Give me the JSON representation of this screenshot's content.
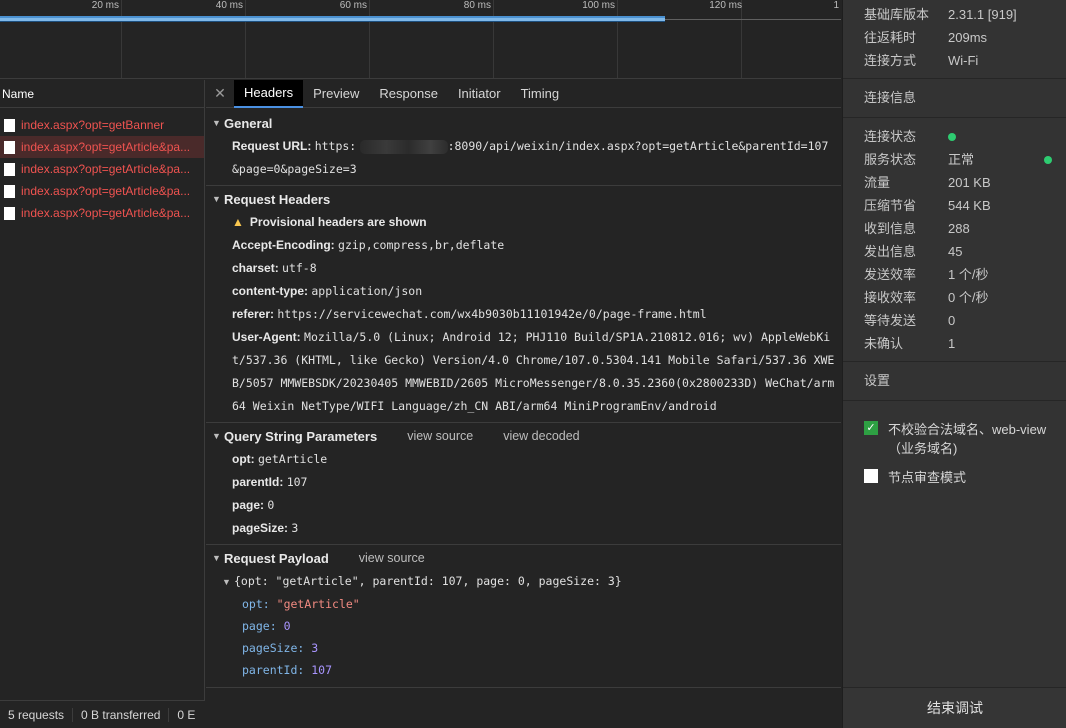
{
  "timeline": {
    "ticks": [
      "20 ms",
      "40 ms",
      "60 ms",
      "80 ms",
      "100 ms",
      "120 ms",
      "1"
    ]
  },
  "list": {
    "header": "Name",
    "requests": [
      "index.aspx?opt=getBanner",
      "index.aspx?opt=getArticle&pa...",
      "index.aspx?opt=getArticle&pa...",
      "index.aspx?opt=getArticle&pa...",
      "index.aspx?opt=getArticle&pa..."
    ]
  },
  "statusbar": {
    "requests": "5 requests",
    "transferred": "0 B transferred",
    "resources": "0 E"
  },
  "tabs": [
    "Headers",
    "Preview",
    "Response",
    "Initiator",
    "Timing"
  ],
  "general": {
    "title": "General",
    "request_url_key": "Request URL:",
    "request_url_prefix": "https:",
    "request_url_rest": ":8090/api/weixin/index.aspx?opt=getArticle&parentId=107",
    "request_url_line2": "&page=0&pageSize=3"
  },
  "request_headers": {
    "title": "Request Headers",
    "provisional": "Provisional headers are shown",
    "items": [
      {
        "k": "Accept-Encoding:",
        "v": "gzip,compress,br,deflate"
      },
      {
        "k": "charset:",
        "v": "utf-8"
      },
      {
        "k": "content-type:",
        "v": "application/json"
      },
      {
        "k": "referer:",
        "v": "https://servicewechat.com/wx4b9030b11101942e/0/page-frame.html"
      }
    ],
    "ua_key": "User-Agent:",
    "ua_val": "Mozilla/5.0 (Linux; Android 12; PHJ110 Build/SP1A.210812.016; wv) AppleWebKit/537.36 (KHTML, like Gecko) Version/4.0 Chrome/107.0.5304.141 Mobile Safari/537.36 XWEB/5057 MMWEBSDK/20230405 MMWEBID/2605 MicroMessenger/8.0.35.2360(0x2800233D) WeChat/arm64 Weixin NetType/WIFI Language/zh_CN ABI/arm64 MiniProgramEnv/android"
  },
  "query": {
    "title": "Query String Parameters",
    "view_source": "view source",
    "view_decoded": "view decoded",
    "items": [
      {
        "k": "opt:",
        "v": "getArticle"
      },
      {
        "k": "parentId:",
        "v": "107"
      },
      {
        "k": "page:",
        "v": "0"
      },
      {
        "k": "pageSize:",
        "v": "3"
      }
    ]
  },
  "payload": {
    "title": "Request Payload",
    "view_source": "view source",
    "summary": "{opt: \"getArticle\", parentId: 107, page: 0, pageSize: 3}",
    "opt_key": "opt:",
    "opt_val": "\"getArticle\"",
    "page_key": "page:",
    "page_val": "0",
    "pagesize_key": "pageSize:",
    "pagesize_val": "3",
    "parentid_key": "parentId:",
    "parentid_val": "107"
  },
  "right": {
    "base": [
      {
        "k": "基础库版本",
        "v": "2.31.1 [919]"
      },
      {
        "k": "往返耗时",
        "v": "209ms"
      },
      {
        "k": "连接方式",
        "v": "Wi-Fi"
      }
    ],
    "conn_title": "连接信息",
    "conn_state_k": "连接状态",
    "service_k": "服务状态",
    "service_v": "正常",
    "stats": [
      {
        "k": "流量",
        "v": "201 KB"
      },
      {
        "k": "压缩节省",
        "v": "544 KB"
      },
      {
        "k": "收到信息",
        "v": "288"
      },
      {
        "k": "发出信息",
        "v": "45"
      },
      {
        "k": "发送效率",
        "v": "1 个/秒"
      },
      {
        "k": "接收效率",
        "v": "0 个/秒"
      },
      {
        "k": "等待发送",
        "v": "0"
      },
      {
        "k": "未确认",
        "v": "1"
      }
    ],
    "settings_title": "设置",
    "opt1": "不校验合法域名、web-view（业务域名)",
    "opt2": "节点审查模式",
    "end_button": "结束调试",
    "status_color": "#2ecc71",
    "checkbox_color": "#2ea043"
  }
}
